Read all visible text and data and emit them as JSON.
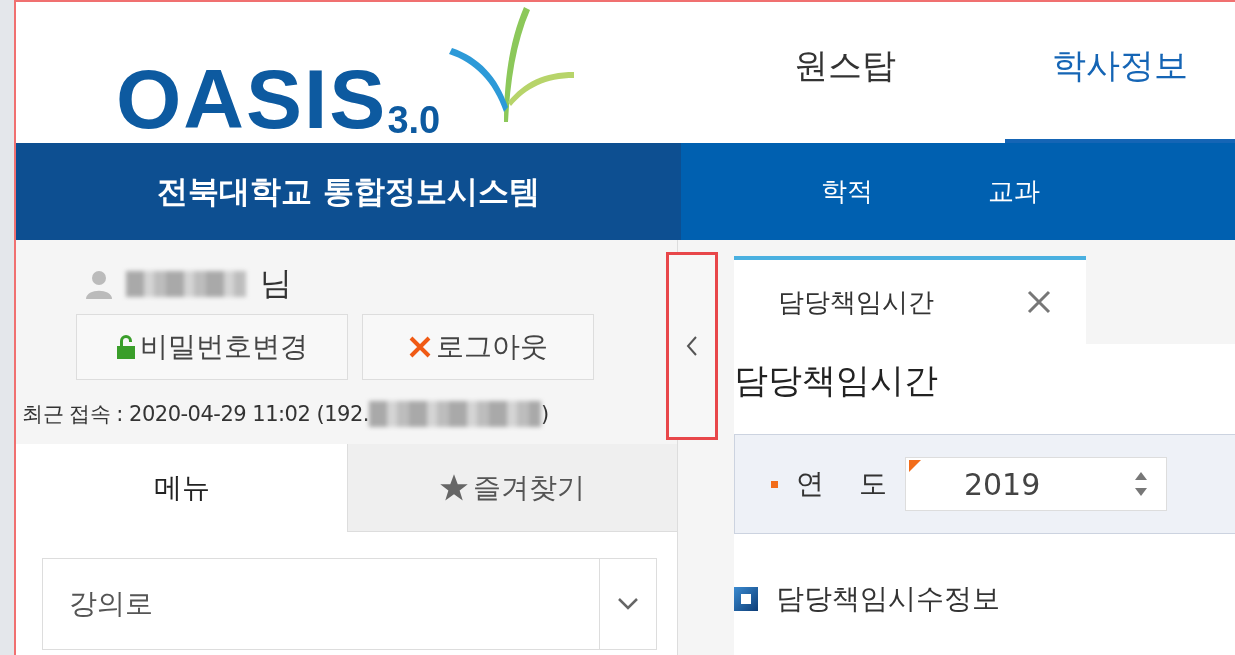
{
  "logo": {
    "text": "OASIS",
    "version": "3.0"
  },
  "site_title": "전북대학교 통합정보시스템",
  "top_nav": [
    {
      "label": "원스탑",
      "selected": false
    },
    {
      "label": "학사정보",
      "selected": true
    }
  ],
  "sub_nav": [
    {
      "label": "학적"
    },
    {
      "label": "교과"
    }
  ],
  "user": {
    "suffix": "님",
    "buttons": [
      {
        "kind": "password",
        "label": "비밀번호변경"
      },
      {
        "kind": "logout",
        "label": "로그아웃"
      }
    ],
    "last_access": "최근 접속 : 2020-04-29 11:02 (192.",
    "last_access_end": ")"
  },
  "sidebar_tabs": [
    {
      "kind": "plain",
      "label": "메뉴",
      "selected": true
    },
    {
      "kind": "favorites",
      "label": "즐겨찾기",
      "selected": false
    }
  ],
  "menu_select": {
    "value": "강의로"
  },
  "sidebar_toggle": {
    "highlighted": true
  },
  "page_tabs": [
    {
      "label": "담당책임시간",
      "selected": true
    }
  ],
  "page_title": "담당책임시간",
  "search": {
    "fields": [
      {
        "label": "연 도",
        "required": true,
        "value": "2019"
      }
    ]
  },
  "sections": [
    {
      "title": "담당책임시수정보"
    }
  ]
}
